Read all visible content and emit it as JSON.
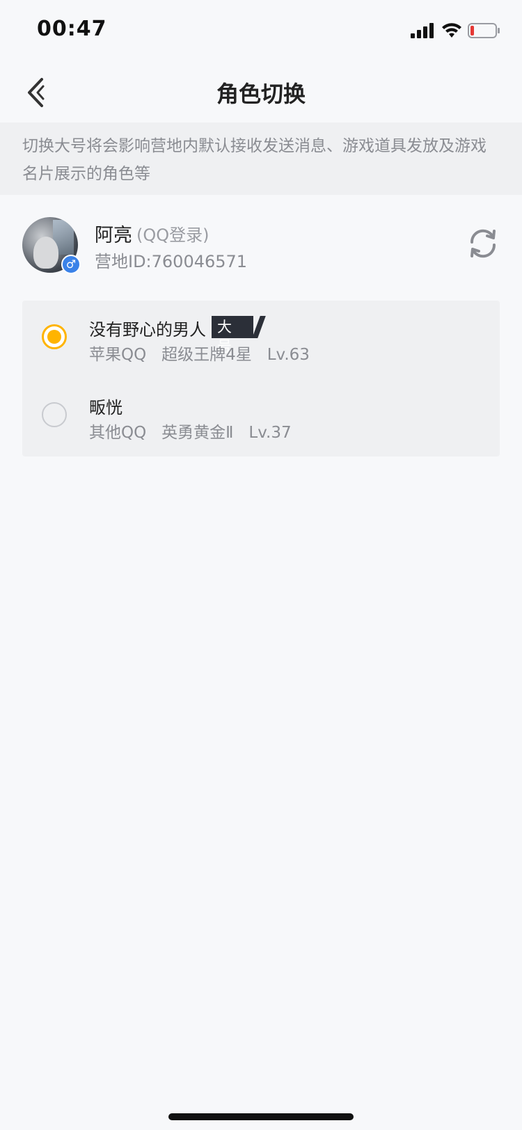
{
  "status_bar": {
    "time": "00:47"
  },
  "nav": {
    "title": "角色切换"
  },
  "notice": "切换大号将会影响营地内默认接收发送消息、游戏道具发放及游戏名片展示的角色等",
  "profile": {
    "name": "阿亮",
    "login_type": "(QQ登录)",
    "camp_id": "营地ID:760046571"
  },
  "roles": [
    {
      "name": "没有野心的男人",
      "tag": "大号",
      "sub": "苹果QQ   超级王牌4星   Lv.63",
      "selected": true
    },
    {
      "name": "畈恍",
      "sub": "其他QQ   英勇黄金Ⅱ   Lv.37",
      "selected": false
    }
  ],
  "colors": {
    "accent": "#ffb400",
    "gender_badge": "#3a82e8",
    "tag_bg": "#2b2f38"
  },
  "icons": {
    "back": "chevron-left-icon",
    "refresh": "refresh-icon",
    "gender": "male-icon"
  }
}
